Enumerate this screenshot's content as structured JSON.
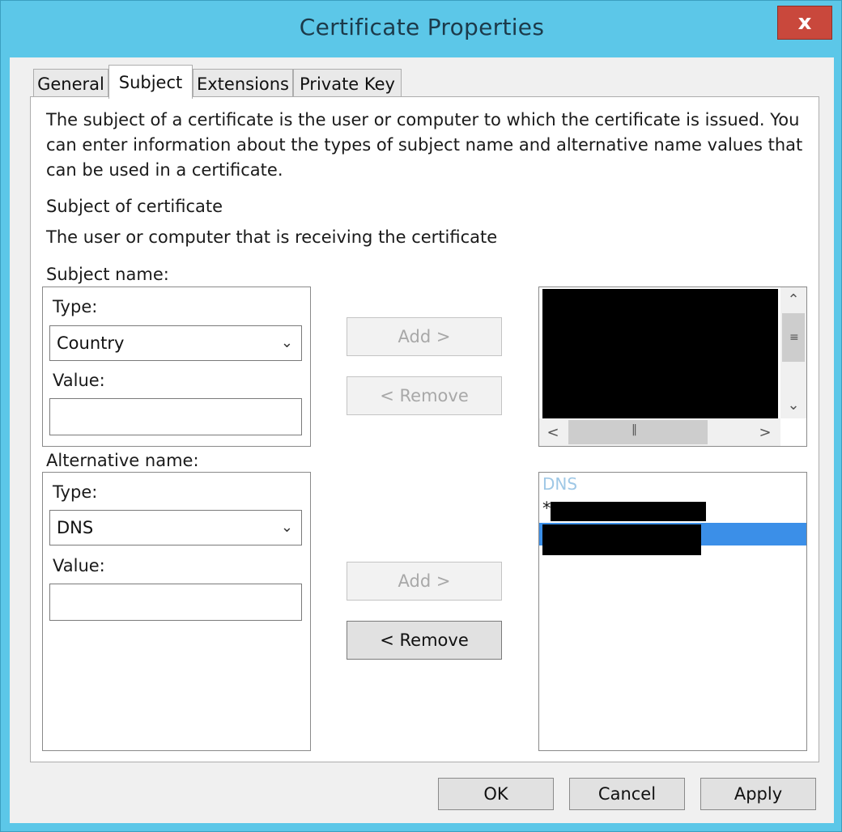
{
  "window": {
    "title": "Certificate Properties",
    "close_glyph": "x",
    "accent_color": "#5cc7e8"
  },
  "tabs": [
    {
      "label": "General",
      "active": false
    },
    {
      "label": "Subject",
      "active": true
    },
    {
      "label": "Extensions",
      "active": false
    },
    {
      "label": "Private Key",
      "active": false
    }
  ],
  "subject_tab": {
    "description_lines": [
      "The subject of a certificate is the user or computer to which the certificate is issued. You",
      "can enter information about the types of subject name and alternative name values that",
      "can be used in a certificate."
    ],
    "section_title": "Subject of certificate",
    "section_subtitle": "The user or computer that is receiving the certificate",
    "subject_name": {
      "label": "Subject name:",
      "type_label": "Type:",
      "type_value": "Country",
      "value_label": "Value:",
      "value": "",
      "add_label": "Add >",
      "remove_label": "< Remove",
      "list_content": "redacted"
    },
    "alternative_name": {
      "label": "Alternative name:",
      "type_label": "Type:",
      "type_value": "DNS",
      "value_label": "Value:",
      "value": "",
      "add_label": "Add >",
      "remove_label": "< Remove",
      "list_header": "DNS",
      "list_items": [
        {
          "prefix": "*",
          "text": "redacted",
          "selected": false
        },
        {
          "prefix": "",
          "text": "redacted",
          "selected": true
        }
      ],
      "selection_color": "#3b8fe8"
    }
  },
  "footer": {
    "ok_label": "OK",
    "cancel_label": "Cancel",
    "apply_label": "Apply"
  },
  "icons": {
    "dropdown": "chevron-down-icon",
    "scroll_up": "chevron-up-icon",
    "scroll_down": "chevron-down-icon",
    "scroll_left": "chevron-left-icon",
    "scroll_right": "chevron-right-icon",
    "grip": "grip-icon"
  }
}
